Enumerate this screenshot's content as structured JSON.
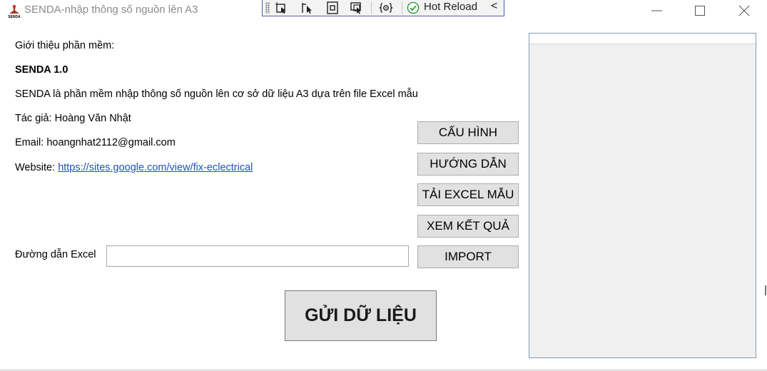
{
  "window": {
    "title": "SENDA-nhập thông số nguồn lên A3",
    "icon": "senda-app-icon",
    "controls": [
      "minimize-icon",
      "maximize-icon",
      "close-icon"
    ]
  },
  "debug_toolbar": {
    "icons": [
      "select-element-icon",
      "display-layout-adorners-icon",
      "track-focused-element-icon",
      "binding-failures-icon",
      "hot-reload-check-icon",
      "collapse-chevron-icon"
    ],
    "hot_reload_label": "Hot Reload",
    "collapse_glyph": "<"
  },
  "about": {
    "intro_label": "Giới thiệu phần mềm:",
    "product_name": "SENDA 1.0",
    "description": "SENDA là phần mềm nhập thông số nguồn lên cơ sở dữ liệu A3 dựa trên file Excel mẫu",
    "author": "Tác giả: Hoàng Văn Nhật",
    "email": "Email: hoangnhat2112@gmail.com",
    "website_label": "Website:",
    "website_url": "https://sites.google.com/view/fix-eclectrical"
  },
  "actions": {
    "config": "CẤU HÌNH",
    "guide": "HƯỚNG DẪN",
    "download_template": "TẢI EXCEL MẪU",
    "view_results": "XEM KẾT QUẢ",
    "import": "IMPORT"
  },
  "excel_path": {
    "label": "Đường dẫn Excel",
    "value": ""
  },
  "send_button": "GỬI DỮ LIỆU",
  "colors": {
    "link": "#1a53b7",
    "button_face": "#e1e1e1",
    "button_border": "#adadad",
    "panel_border": "#7f9db9",
    "toolbar_border": "#4d5dad",
    "hot_reload_green": "#2e9e3e",
    "title_text": "#8a8a8a"
  }
}
